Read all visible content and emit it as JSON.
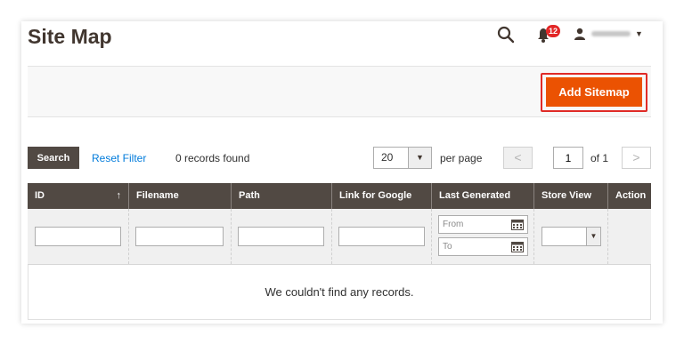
{
  "header": {
    "title": "Site Map",
    "notification_count": "12",
    "icons": {
      "search": "search-icon",
      "notifications": "bell-icon",
      "user": "user-icon",
      "dropdown": "caret-down-icon"
    }
  },
  "actions": {
    "add_sitemap_label": "Add Sitemap"
  },
  "toolbar": {
    "search_label": "Search",
    "reset_filter_label": "Reset Filter",
    "records_found": "0 records found",
    "per_page_value": "20",
    "per_page_label": "per page",
    "prev_label": "<",
    "current_page": "1",
    "of_pages": "of 1",
    "next_label": ">"
  },
  "grid": {
    "columns": [
      "ID",
      "Filename",
      "Path",
      "Link for Google",
      "Last Generated",
      "Store View",
      "Action"
    ],
    "sort_indicator": "↑",
    "date_from_placeholder": "From",
    "date_to_placeholder": "To",
    "empty_message": "We couldn't find any records."
  },
  "colors": {
    "accent": "#eb5202",
    "header_bg": "#514943",
    "link": "#007bdb",
    "highlight": "#e02b27"
  }
}
